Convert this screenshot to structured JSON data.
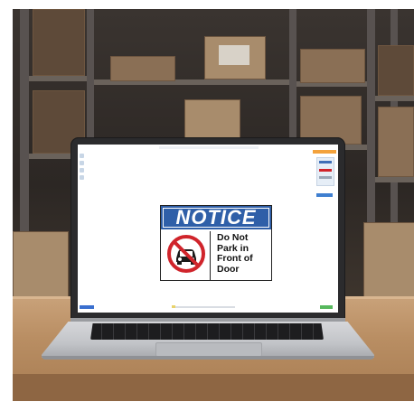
{
  "sign": {
    "title": "NOTICE",
    "lines": [
      "Do Not",
      "Park in",
      "Front of",
      "Door"
    ],
    "header_color": "#2f5fa8",
    "prohibition_color": "#d0242b",
    "icon": "no-parking-car-icon"
  },
  "editor": {
    "panel_tab_color": "#f3a23c",
    "status_left_color": "#3a6fcf",
    "status_right_color": "#57b85d"
  }
}
